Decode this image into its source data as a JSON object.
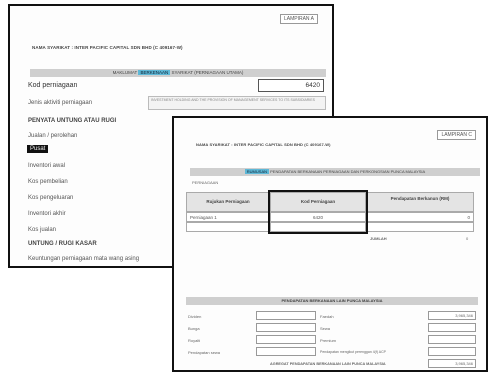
{
  "back_form": {
    "lampiran": "LAMPIRAN A",
    "company": "NAMA SYARIKAT : INTER PACIFIC CAPITAL SDN BHD (C 409167-W)",
    "section_prefix": "MAKLUMAT",
    "section_highlight": "BERKENAAN",
    "section_suffix": "SYARIKAT (PERNIAGAAN UTAMA)",
    "kod_label": "Kod perniagaan",
    "kod_value": "6420",
    "jenis_label": "Jenis aktiviti perniagaan",
    "jenis_value": "INVESTMENT HOLDING AND THE PROVISION OF MANAGEMENT SERVICES TO ITS SUBSIDIARIES",
    "penyata_heading": "PENYATA UNTUNG ATAU RUGI",
    "items": [
      "Jualan / perolehan",
      "Pusat",
      "Inventori awal",
      "Kos pembelian",
      "Kos pengeluaran",
      "Inventori akhir",
      "Kos jualan"
    ],
    "untung_heading": "UNTUNG / RUGI KASAR",
    "last_item": "Keuntungan perniagaan mata wang asing"
  },
  "front_form": {
    "lampiran": "LAMPIRAN C",
    "company": "NAMA SYARIKAT : INTER PACIFIC CAPITAL SDN BHD (C 409167-W)",
    "section_highlight": "RUMUSAN",
    "section_suffix": "PENDAPATAN BERKANAAN PERNIAGAAN DAN PERKONGSIAN PUNCA MALAYSIA",
    "sub_label": "PERNIAGAAN",
    "table": {
      "headers": [
        "Rujukan Perniagaan",
        "Kod Perniagaan",
        "Pendapatan Berkanun (RM)"
      ],
      "rows": [
        {
          "ref": "Perniagaan 1",
          "kod": "6420",
          "amount": "0"
        },
        {
          "ref": "",
          "kod": "",
          "amount": ""
        }
      ],
      "jumlah_label": "JUMLAH",
      "jumlah_value": "0"
    },
    "lain": {
      "heading": "PENDAPATAN BERKANAAN LAIN PUNCA MALAYSIA",
      "left_labels": [
        "Dividen",
        "Bunga",
        "Royalti",
        "Pendapatan sewa"
      ],
      "right_labels": [
        "Faedah",
        "Sewa",
        "Premium",
        "Pendapatan mengikut perenggan 4(f) ACP"
      ],
      "right_values": [
        "3,965,346",
        "",
        "",
        ""
      ],
      "total_label": "AGREGAT PENDAPATAN BERKANAAN LAIN PUNCA MALAYSIA",
      "total_value": "3,965,346"
    }
  }
}
